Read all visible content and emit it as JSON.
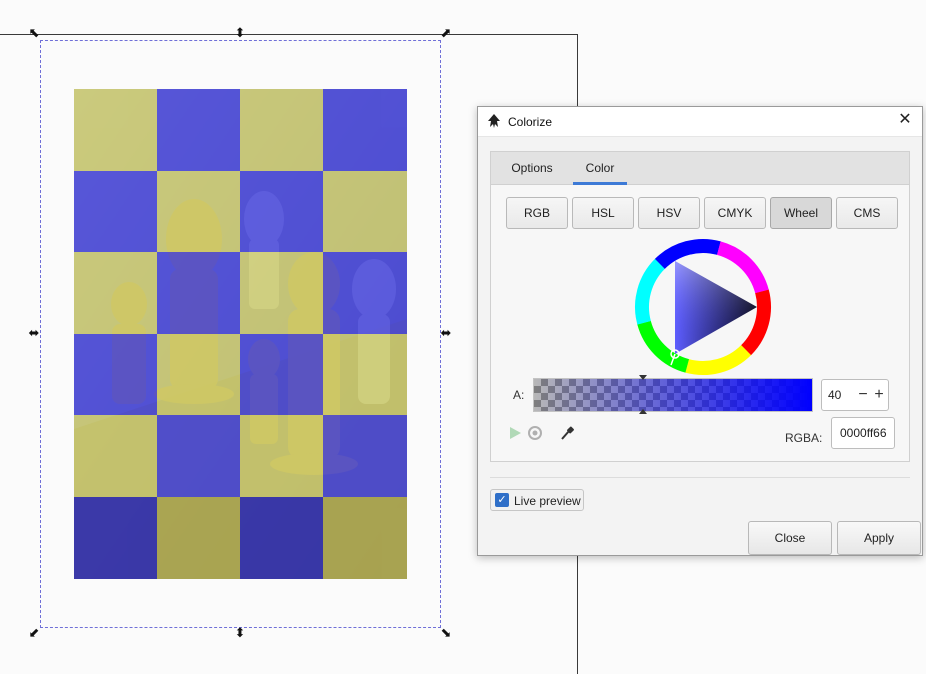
{
  "dialog": {
    "title": "Colorize",
    "tabs": [
      {
        "label": "Options",
        "active": false
      },
      {
        "label": "Color",
        "active": true
      }
    ],
    "modes": [
      {
        "label": "RGB",
        "active": false
      },
      {
        "label": "HSL",
        "active": false
      },
      {
        "label": "HSV",
        "active": false
      },
      {
        "label": "CMYK",
        "active": false
      },
      {
        "label": "Wheel",
        "active": true
      },
      {
        "label": "CMS",
        "active": false
      }
    ],
    "alpha": {
      "label": "A:",
      "value": "40"
    },
    "rgba": {
      "label": "RGBA:",
      "value": "0000ff66"
    },
    "live_preview": {
      "label": "Live preview",
      "checked": true
    },
    "buttons": {
      "close": "Close",
      "apply": "Apply"
    }
  },
  "colors": {
    "accent": "#3d7ad6",
    "picked": "#0000ff",
    "tint_blue": "#4a4ae0",
    "tint_yellow": "#d6d670"
  },
  "icons": {
    "window_close": "close-icon",
    "app": "inkscape-icon",
    "eyedropper": "eyedropper-icon",
    "gamut": "gamut-warning-icon",
    "color_managed": "color-managed-icon"
  }
}
